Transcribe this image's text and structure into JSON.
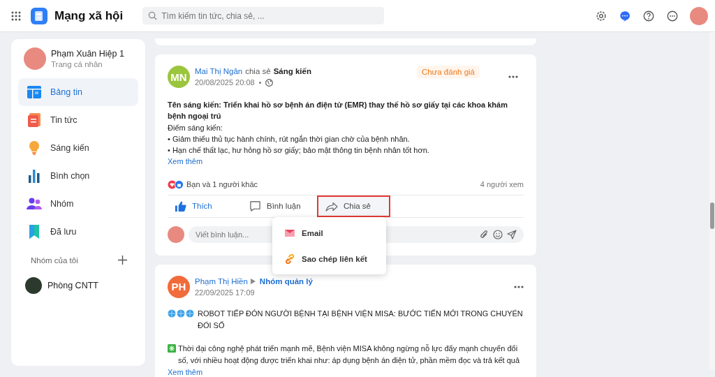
{
  "header": {
    "app_title": "Mạng xã hội",
    "search": {
      "placeholder": "Tìm kiếm tin tức, chia sẻ, ..."
    }
  },
  "sidebar": {
    "profile": {
      "name": "Phạm Xuân Hiệp 1",
      "subtitle": "Trang cá nhân"
    },
    "items": [
      {
        "label": "Bảng tin",
        "kind": "feed",
        "selected": true
      },
      {
        "label": "Tin tức",
        "kind": "news",
        "selected": false
      },
      {
        "label": "Sáng kiến",
        "kind": "idea",
        "selected": false
      },
      {
        "label": "Bình chọn",
        "kind": "poll",
        "selected": false
      },
      {
        "label": "Nhóm",
        "kind": "group",
        "selected": false
      },
      {
        "label": "Đã lưu",
        "kind": "saved",
        "selected": false
      }
    ],
    "groups_heading": "Nhóm của tôi",
    "groups": [
      {
        "name": "Phòng CNTT"
      }
    ]
  },
  "posts": [
    {
      "kind": "share",
      "initials": "MN",
      "color": "#9bc53d",
      "author": "Mai Thị Ngân",
      "verb": "chia sẻ",
      "target": "Sáng kiến",
      "badge": "Chưa đánh giá",
      "time": "20/08/2025 20:08",
      "title": "Tên sáng kiến: Triển khai hồ sơ bệnh án điện tử (EMR) thay thế hồ sơ giấy tại các khoa khám bệnh ngoại trú",
      "lines": [
        "Điểm sáng kiến:",
        "• Giảm thiểu thủ tục hành chính, rút ngắn thời gian chờ của bệnh nhân.",
        "• Hạn chế thất lạc, hư hỏng hồ sơ giấy; bảo mật thông tin bệnh nhân tốt hơn."
      ],
      "more": "Xem thêm",
      "reactions": "Bạn và 1 người khác",
      "views": "4 người xem",
      "actions": [
        {
          "kind": "like",
          "label": "Thích",
          "active": true,
          "selected": false
        },
        {
          "kind": "comment",
          "label": "Bình luận",
          "active": false,
          "selected": false
        },
        {
          "kind": "share",
          "label": "Chia sẻ",
          "active": false,
          "selected": true
        }
      ],
      "comment_placeholder": "Viết bình luận...",
      "share_menu": [
        {
          "kind": "email",
          "label": "Email"
        },
        {
          "kind": "link",
          "label": "Sao chép liên kết"
        }
      ]
    },
    {
      "kind": "group",
      "initials": "PH",
      "color": "#f26b3a",
      "author": "Phạm Thị Hiền",
      "target": "Nhóm quản lý",
      "time": "22/09/2025 17:09",
      "paragraphs": [
        {
          "kind": "globes",
          "text": "ROBOT TIẾP ĐÓN NGƯỜI BỆNH TẠI BỆNH VIỆN MISA: BƯỚC TIẾN MỚI TRONG CHUYỂN ĐỔI SỐ"
        },
        {
          "kind": "sparkle",
          "text": "Thời đại công nghệ phát triển mạnh mẽ, Bệnh viện MISA không ngừng nỗ lực đẩy mạnh chuyển đổi số, với nhiều hoạt động được triển khai như: áp dụng bệnh án điện tử, phần mềm đọc và trả kết quả"
        }
      ],
      "more": "Xem thêm"
    }
  ]
}
